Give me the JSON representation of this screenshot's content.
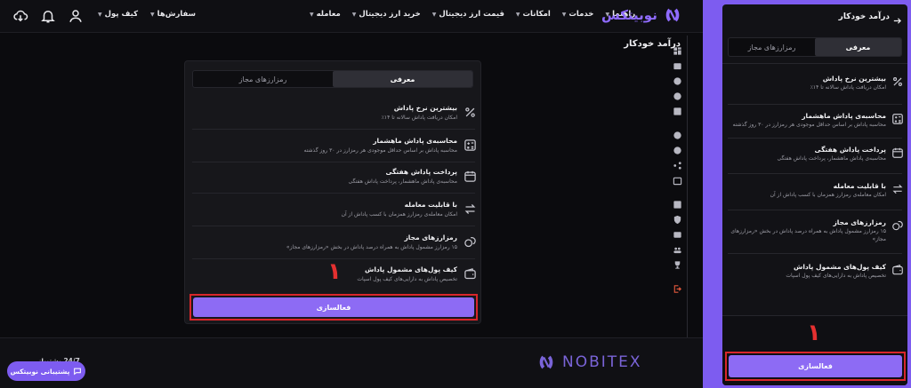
{
  "colors": {
    "accent": "#8d6bf4",
    "brand": "#7d5cf0",
    "highlight": "#d8262b",
    "background": "#0b0b0e",
    "card": "#17171b"
  },
  "nav": {
    "brand": "نوبیتکس",
    "main_menu": [
      "معامله",
      "خرید ارز دیجیتال",
      "قیمت ارز دیجیتال",
      "امکانات",
      "خدمات",
      "راهنما"
    ],
    "left_menu": [
      "سفارش‌ها",
      "کیف پول"
    ],
    "icons": [
      "download-icon",
      "bell-icon",
      "user-icon"
    ]
  },
  "page": {
    "title": "درآمد خودکار",
    "tabs": {
      "intro": "معرفی",
      "allowed_coins": "رمزارزهای مجاز"
    },
    "features": [
      {
        "icon": "percent-icon",
        "title": "بیشترین نرخ پاداش",
        "desc": "امکان دریافت پاداش سالانه تا ۱۴٪"
      },
      {
        "icon": "calculator-icon",
        "title": "محاسبه‌ی پاداش ماهشمار",
        "desc": "محاسبه پاداش بر اساس حداقل موجودی هر رمزارز در ۳۰ روز گذشته"
      },
      {
        "icon": "calendar-icon",
        "title": "پرداخت پاداش هفتگی",
        "desc": "محاسبه‌ی پاداش ماهشمار، پرداخت پاداش هفتگی"
      },
      {
        "icon": "swap-icon",
        "title": "با قابلیت معامله",
        "desc": "امکان معامله‌ی رمزارز همزمان با کسب پاداش از آن"
      },
      {
        "icon": "coins-icon",
        "title": "رمزارزهای مجاز",
        "desc": "۱۵ رمزارز مشمول پاداش به همراه درصد پاداش در بخش «رمزارزهای مجاز»"
      },
      {
        "icon": "wallet-icon",
        "title": "کیف پول‌های مشمول پاداش",
        "desc": "تخصیص پاداش به دارایی‌های کیف پول اسپات"
      }
    ],
    "activate_label": "فعالسازی",
    "step_marker": "۱"
  },
  "footer": {
    "support_label": "پشتیبانی نوبیتکس",
    "availability": "24/7  پشتیبانی",
    "logo_text": "NOBITEX"
  },
  "mobile": {
    "title": "درآمد خودکار",
    "activate_label": "فعالسازی",
    "step_marker": "۱"
  }
}
